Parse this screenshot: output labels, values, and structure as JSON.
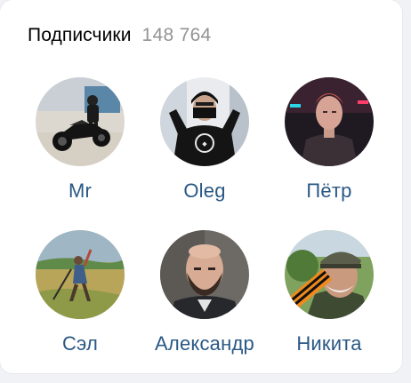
{
  "followers": {
    "title": "Подписчики",
    "count": "148 764",
    "items": [
      {
        "name": "Mr"
      },
      {
        "name": "Oleg"
      },
      {
        "name": "Пётр"
      },
      {
        "name": "Сэл"
      },
      {
        "name": "Александр"
      },
      {
        "name": "Никита"
      }
    ]
  },
  "colors": {
    "link": "#2a5885",
    "title": "#000000",
    "count": "#939393",
    "background": "#ffffff"
  }
}
